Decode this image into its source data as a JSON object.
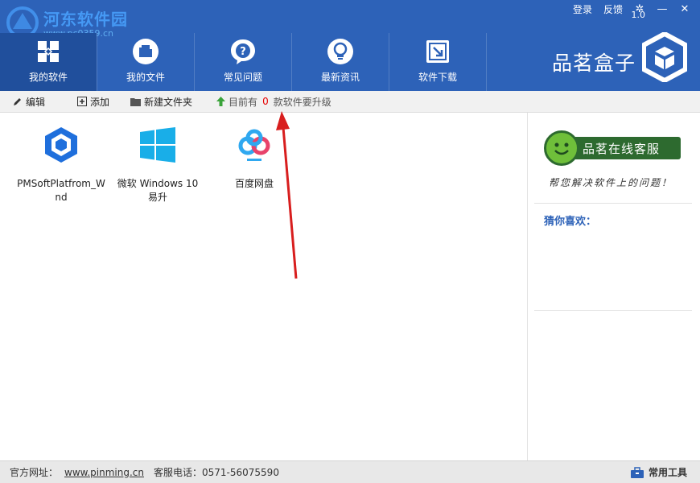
{
  "window": {
    "login": "登录",
    "feedback": "反馈",
    "settings_icon": "gear-icon",
    "minimize_icon": "minimize-icon",
    "close_icon": "close-icon"
  },
  "watermark": {
    "title": "河东软件园",
    "url": "www.pc0359.cn"
  },
  "nav": {
    "tabs": [
      {
        "label": "我的软件",
        "icon": "grid-apps-icon",
        "active": true
      },
      {
        "label": "我的文件",
        "icon": "folder-icon",
        "active": false
      },
      {
        "label": "常见问题",
        "icon": "question-bubble-icon",
        "active": false
      },
      {
        "label": "最新资讯",
        "icon": "lightbulb-icon",
        "active": false
      },
      {
        "label": "软件下载",
        "icon": "download-box-icon",
        "active": false
      }
    ]
  },
  "brand": {
    "name": "品茗盒子",
    "version": "1.0"
  },
  "toolbar": {
    "edit": "编辑",
    "add": "添加",
    "new_folder": "新建文件夹",
    "update_prefix": "目前有",
    "update_count": "0",
    "update_suffix": "款软件要升级"
  },
  "apps": [
    {
      "label": "PMSoftPlatfrom_Wnd",
      "icon": "pmsoft-cube-icon"
    },
    {
      "label": "微软 Windows 10 易升",
      "icon": "windows-logo-icon"
    },
    {
      "label": "百度网盘",
      "icon": "baidu-netdisk-icon"
    }
  ],
  "side": {
    "service_label": "品茗在线客服",
    "service_tagline": "帮您解决软件上的问题！",
    "guess_title": "猜你喜欢："
  },
  "status": {
    "site_label": "官方网址：",
    "site_url": "www.pinming.cn",
    "phone": "客服电话：0571-56075590",
    "tools": "常用工具"
  },
  "colors": {
    "header_blue": "#2d62b8",
    "active_tab": "#204f9c",
    "service_green": "#2d6a2f",
    "update_red": "#e60000",
    "annotation_red": "#d81e1e"
  }
}
